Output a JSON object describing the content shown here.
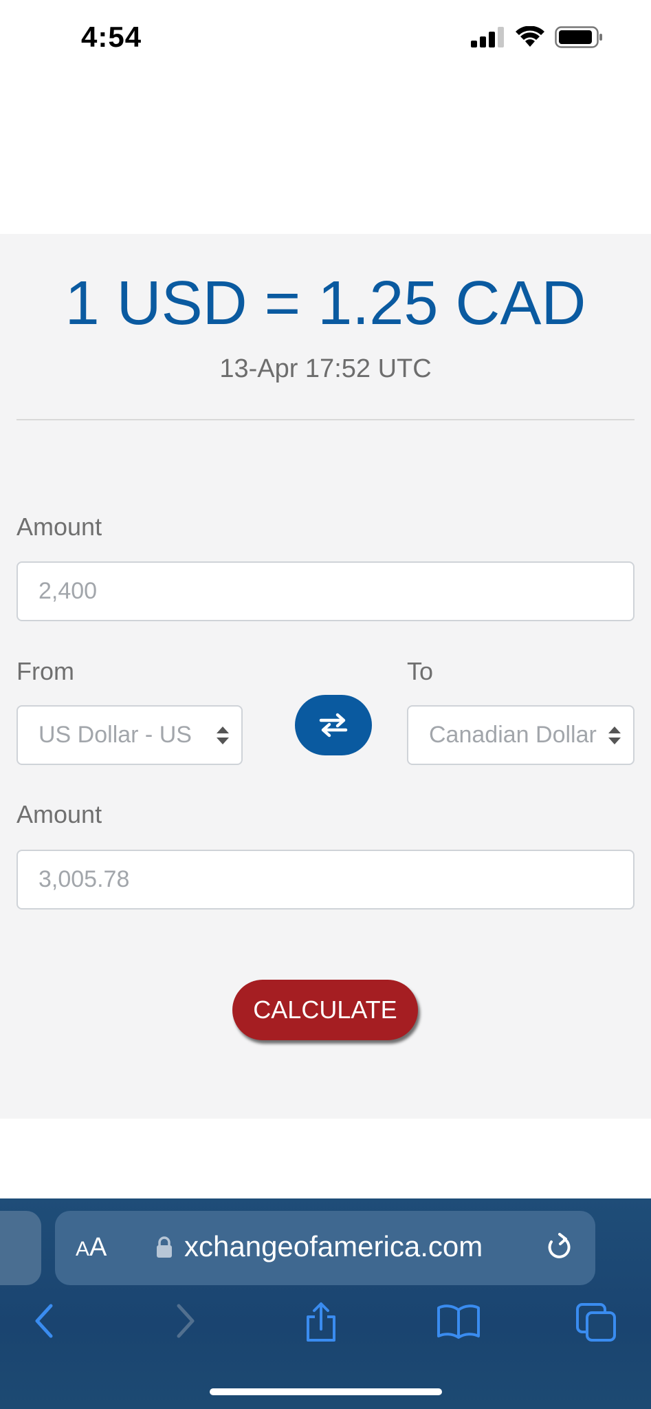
{
  "status_bar": {
    "time": "4:54"
  },
  "converter": {
    "rate_headline": "1 USD = 1.25 CAD",
    "rate_timestamp": "13-Apr 17:52 UTC",
    "amount_label": "Amount",
    "amount_value": "2,400",
    "from_label": "From",
    "from_value": "US Dollar - US",
    "to_label": "To",
    "to_value": "Canadian Dollar",
    "result_label": "Amount",
    "result_value": "3,005.78",
    "calculate_label": "CALCULATE"
  },
  "browser": {
    "text_size_label_small": "A",
    "text_size_label_large": "A",
    "url": "xchangeofamerica.com"
  },
  "colors": {
    "accent_blue": "#0a5aa0",
    "calculate_red": "#a51e22",
    "panel_bg": "#f4f4f5",
    "browser_bar": "#1f4d78"
  }
}
